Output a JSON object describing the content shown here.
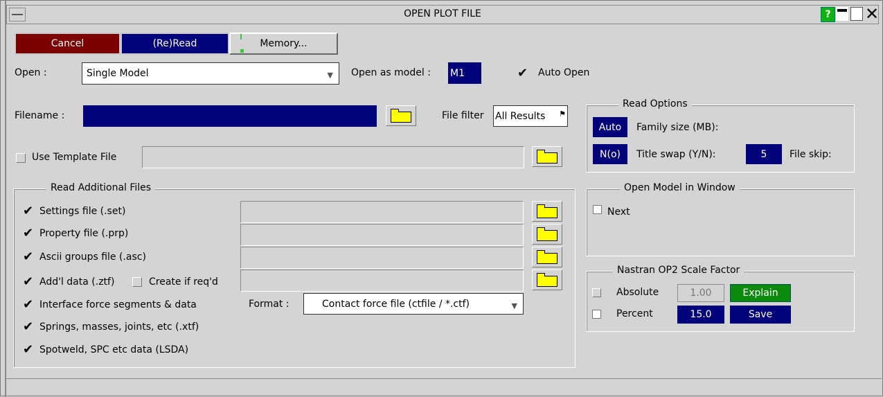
{
  "window": {
    "title": "OPEN PLOT FILE",
    "help_label": "?"
  },
  "toolbar": {
    "cancel_label": "Cancel",
    "reread_label": "(Re)Read",
    "memory_label": "Memory..."
  },
  "open": {
    "label": "Open :",
    "mode_value": "Single Model",
    "model_label": "Open as model :",
    "model_value": "M1",
    "auto_open_label": "Auto Open",
    "auto_open_checked": true
  },
  "filename": {
    "label": "Filename :",
    "value": "",
    "filter_label": "File filter",
    "filter_value": "All Results"
  },
  "template": {
    "label": "Use Template File",
    "checked": false,
    "value": ""
  },
  "additional_files": {
    "title": "Read Additional Files",
    "items": [
      {
        "label": "Settings file (.set)",
        "checked": true
      },
      {
        "label": "Property file (.prp)",
        "checked": true
      },
      {
        "label": "Ascii groups file (.asc)",
        "checked": true
      },
      {
        "label": "Add'l data (.ztf)",
        "checked": true
      },
      {
        "label": "Interface force segments & data",
        "checked": true
      },
      {
        "label": "Springs, masses, joints, etc (.xtf)",
        "checked": true
      },
      {
        "label": "Spotweld, SPC etc data (LSDA)",
        "checked": true
      }
    ],
    "create_label": "Create if req'd",
    "create_checked": false,
    "format_label": "Format :",
    "format_value": "Contact force file (ctfile / *.ctf)"
  },
  "read_options": {
    "title": "Read Options",
    "family_value": "Auto",
    "family_label": "Family size (MB):",
    "title_swap_value": "N(o)",
    "title_swap_label": "Title swap (Y/N):",
    "file_skip_value": "5",
    "file_skip_label": "File skip:"
  },
  "open_model_window": {
    "title": "Open Model in Window",
    "next_label": "Next",
    "next_checked": false
  },
  "nastran": {
    "title": "Nastran OP2 Scale Factor",
    "absolute_label": "Absolute",
    "absolute_value": "1.00",
    "explain_label": "Explain",
    "percent_label": "Percent",
    "percent_value": "15.0",
    "save_label": "Save"
  },
  "icons": {
    "check": "✔",
    "dropdown_arrow": "▼",
    "close": "✕",
    "filter_flag": "⚑"
  },
  "colors": {
    "navy": "#02027a",
    "cancel_red": "#7c0000",
    "green": "#0b8a0b",
    "folder_yellow": "#ffff00"
  }
}
